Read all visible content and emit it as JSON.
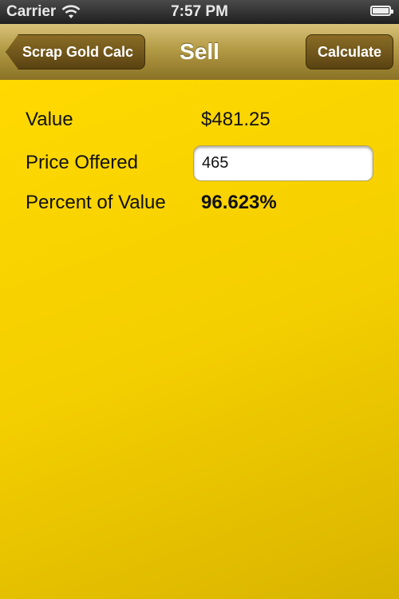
{
  "status_bar": {
    "carrier": "Carrier",
    "time": "7:57 PM"
  },
  "nav": {
    "back_label": "Scrap Gold Calc",
    "title": "Sell",
    "action_label": "Calculate"
  },
  "form": {
    "value_label": "Value",
    "value": "$481.25",
    "price_label": "Price Offered",
    "price_value": "465",
    "percent_label": "Percent of Value",
    "percent_value": "96.623%"
  },
  "colors": {
    "background": "#ffd900",
    "nav_gradient_top": "#d8c27a",
    "button_fill": "#6b521a"
  },
  "icons": [
    "wifi-icon",
    "battery-icon"
  ]
}
